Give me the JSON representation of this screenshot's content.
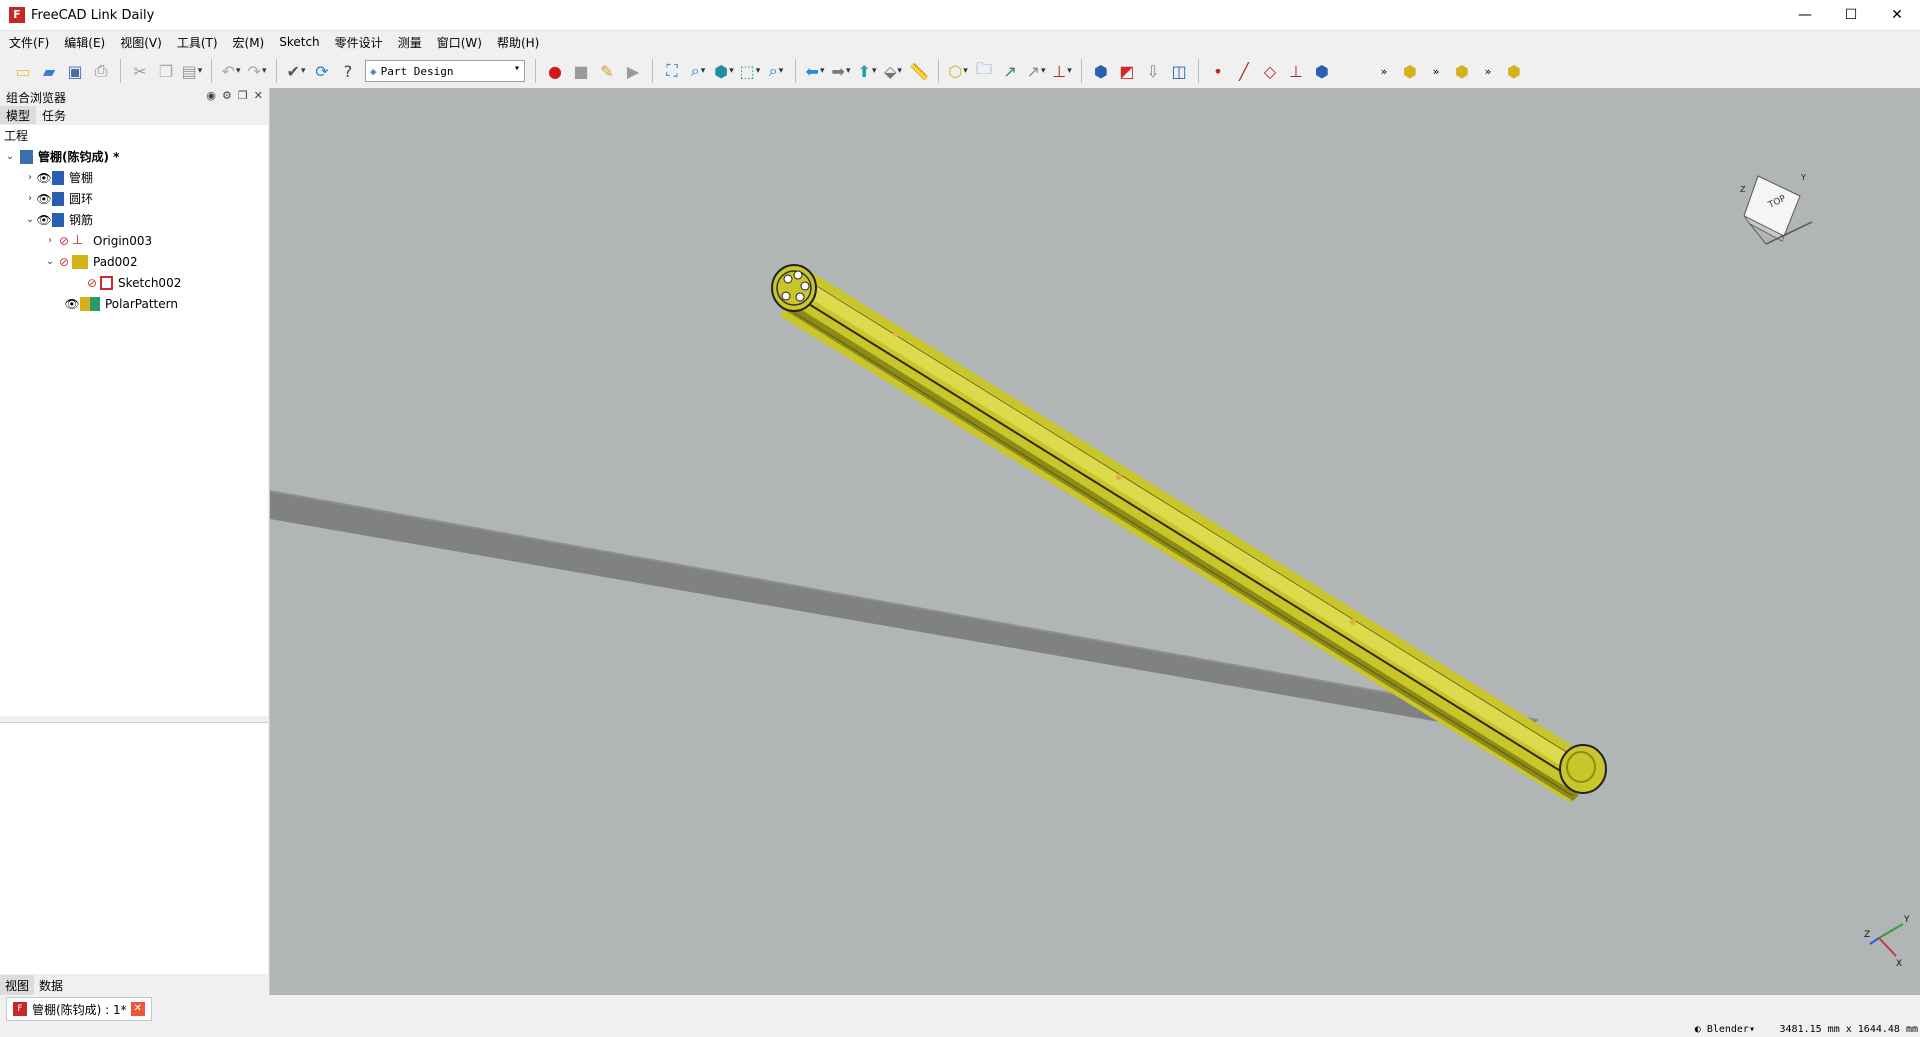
{
  "window": {
    "title": "FreeCAD Link Daily",
    "minimize": "—",
    "maximize": "☐",
    "close": "✕"
  },
  "menu": [
    "文件(F)",
    "编辑(E)",
    "视图(V)",
    "工具(T)",
    "宏(M)",
    "Sketch",
    "零件设计",
    "测量",
    "窗口(W)",
    "帮助(H)"
  ],
  "toolbar": {
    "workbench": "Part Design"
  },
  "panel": {
    "title": "组合浏览器",
    "tabs": [
      "模型",
      "任务"
    ],
    "section": "工程",
    "tree": [
      {
        "label": "管棚(陈钧成) *",
        "level": 0,
        "twisty": "⌄"
      },
      {
        "label": "管棚",
        "level": 1,
        "twisty": "›"
      },
      {
        "label": "圆环",
        "level": 1,
        "twisty": "›"
      },
      {
        "label": "钢筋",
        "level": 1,
        "twisty": "⌄"
      },
      {
        "label": "Origin003",
        "level": 2,
        "twisty": "›"
      },
      {
        "label": "Pad002",
        "level": 2,
        "twisty": "⌄"
      },
      {
        "label": "Sketch002",
        "level": 3,
        "twisty": ""
      },
      {
        "label": "PolarPattern",
        "level": 2,
        "twisty": ""
      }
    ],
    "bottom_tabs": [
      "视图",
      "数据"
    ]
  },
  "viewport": {
    "background": "#b2b5b5",
    "nav_cube": {
      "face_label": "TOP",
      "axis_z": "Z",
      "axis_y": "Y"
    },
    "axes": {
      "x": "X",
      "y": "Y",
      "z": "Z"
    },
    "part_color": "#c8c62a"
  },
  "doc_tab": {
    "label": "管棚(陈钧成) : 1*"
  },
  "status": {
    "navigation": "Blender",
    "dimensions": "3481.15 mm x 1644.48 mm"
  }
}
